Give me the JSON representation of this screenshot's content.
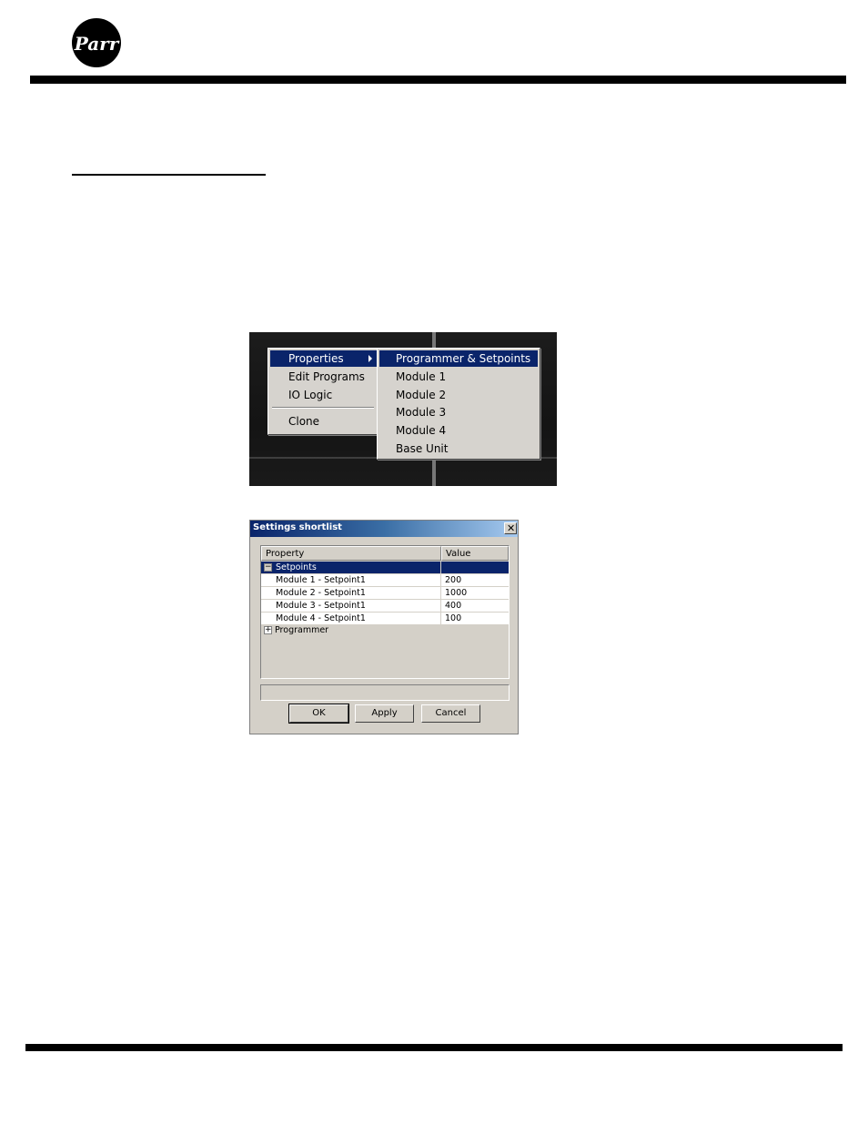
{
  "brand": {
    "logo_text": "Parr"
  },
  "context_menu": {
    "items": [
      {
        "label": "Properties",
        "selected": true,
        "has_submenu": true
      },
      {
        "label": "Edit Programs"
      },
      {
        "label": "IO Logic"
      },
      {
        "label": "Clone"
      }
    ],
    "submenu": [
      {
        "label": "Programmer & Setpoints",
        "selected": true
      },
      {
        "label": "Module 1"
      },
      {
        "label": "Module 2"
      },
      {
        "label": "Module 3"
      },
      {
        "label": "Module 4"
      },
      {
        "label": "Base Unit"
      }
    ]
  },
  "dialog": {
    "title": "Settings shortlist",
    "close_glyph": "✕",
    "columns": {
      "property": "Property",
      "value": "Value"
    },
    "groups": [
      {
        "name": "Setpoints",
        "expanded": true,
        "expander": "−",
        "rows": [
          {
            "property": "Module 1 - Setpoint1",
            "value": "200"
          },
          {
            "property": "Module 2 - Setpoint1",
            "value": "1000"
          },
          {
            "property": "Module 3 - Setpoint1",
            "value": "400"
          },
          {
            "property": "Module 4 - Setpoint1",
            "value": "100"
          }
        ]
      },
      {
        "name": "Programmer",
        "expanded": false,
        "expander": "+"
      }
    ],
    "buttons": {
      "ok": "OK",
      "apply": "Apply",
      "cancel": "Cancel"
    }
  },
  "colors": {
    "selection": "#0a246a",
    "menu_bg": "#d6d3ce",
    "dialog_bg": "#d4d0c8"
  }
}
